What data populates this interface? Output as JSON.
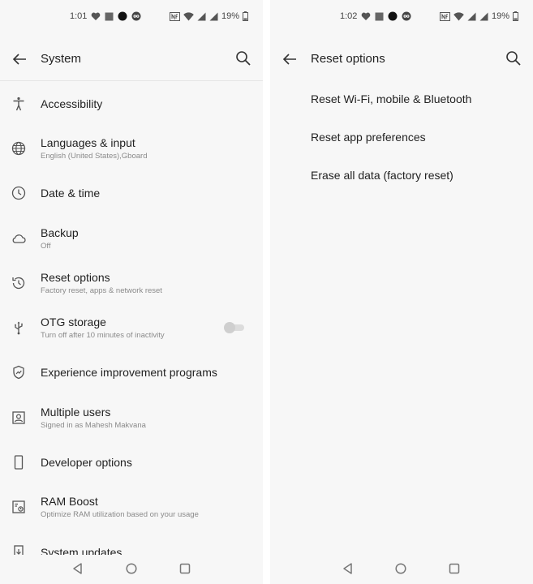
{
  "colors": {
    "background": "#f7f7f7",
    "text_primary": "#222222",
    "text_secondary": "#8a8a8a",
    "icon": "#555555"
  },
  "left_screen": {
    "status_bar": {
      "time": "1:01",
      "battery": "19%",
      "notification_icons": [
        "heart-icon",
        "square-icon",
        "circle-icon",
        "infinity-icon"
      ],
      "system_icons": [
        "nfc-icon",
        "wifi-icon",
        "signal-icon",
        "signal-icon",
        "battery-icon"
      ]
    },
    "toolbar": {
      "title": "System",
      "back_icon": "arrow-left-icon",
      "search_icon": "search-icon"
    },
    "items": [
      {
        "icon": "accessibility-icon",
        "title": "Accessibility",
        "subtitle": ""
      },
      {
        "icon": "globe-icon",
        "title": "Languages & input",
        "subtitle": "English (United States),Gboard"
      },
      {
        "icon": "clock-icon",
        "title": "Date & time",
        "subtitle": ""
      },
      {
        "icon": "cloud-icon",
        "title": "Backup",
        "subtitle": "Off"
      },
      {
        "icon": "history-icon",
        "title": "Reset options",
        "subtitle": "Factory reset, apps & network reset"
      },
      {
        "icon": "usb-icon",
        "title": "OTG storage",
        "subtitle": "Turn off after 10 minutes of inactivity",
        "toggle": false
      },
      {
        "icon": "shield-icon",
        "title": "Experience improvement programs",
        "subtitle": ""
      },
      {
        "icon": "user-icon",
        "title": "Multiple users",
        "subtitle": "Signed in as Mahesh Makvana"
      },
      {
        "icon": "phone-icon",
        "title": "Developer options",
        "subtitle": ""
      },
      {
        "icon": "ram-icon",
        "title": "RAM Boost",
        "subtitle": "Optimize RAM utilization based on your usage"
      },
      {
        "icon": "system-update-icon",
        "title": "System updates",
        "subtitle": ""
      }
    ]
  },
  "right_screen": {
    "status_bar": {
      "time": "1:02",
      "battery": "19%"
    },
    "toolbar": {
      "title": "Reset options",
      "back_icon": "arrow-left-icon",
      "search_icon": "search-icon"
    },
    "items": [
      {
        "title": "Reset Wi-Fi, mobile & Bluetooth"
      },
      {
        "title": "Reset app preferences"
      },
      {
        "title": "Erase all data (factory reset)"
      }
    ]
  },
  "nav_bar": {
    "back_icon": "triangle-back-icon",
    "home_icon": "circle-home-icon",
    "recents_icon": "square-recents-icon"
  }
}
